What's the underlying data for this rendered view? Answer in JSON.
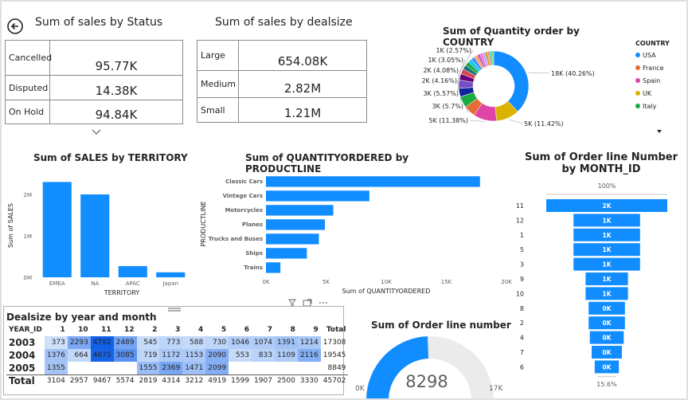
{
  "colors": {
    "accent": "#118DFF",
    "usa": "#118DFF",
    "france": "#E66C37",
    "spain": "#E044A7",
    "uk": "#D9B300",
    "italy": "#1AAB40"
  },
  "status_card": {
    "title": "Sum of sales by Status",
    "back_icon": "back-arrow-icon",
    "rows": [
      {
        "label": "Cancelled",
        "value": "95.77K"
      },
      {
        "label": "Disputed",
        "value": "14.38K"
      },
      {
        "label": "On Hold",
        "value": "94.84K"
      }
    ],
    "scroll_icon": "chevron-down-icon"
  },
  "dealsize_card": {
    "title": "Sum of sales by dealsize",
    "rows": [
      {
        "label": "Large",
        "value": "654.08K"
      },
      {
        "label": "Medium",
        "value": "2.82M"
      },
      {
        "label": "Small",
        "value": "1.21M"
      }
    ]
  },
  "country_chart": {
    "title": "Sum of Quantity order by COUNTRY",
    "legend_title": "COUNTRY",
    "legend": [
      {
        "name": "USA",
        "color": "#118DFF"
      },
      {
        "name": "France",
        "color": "#E66C37"
      },
      {
        "name": "Spain",
        "color": "#E044A7"
      },
      {
        "name": "UK",
        "color": "#D9B300"
      },
      {
        "name": "Italy",
        "color": "#1AAB40"
      }
    ],
    "more_icon": "dropdown-triangle-icon",
    "chart_data": {
      "type": "pie",
      "variant": "donut",
      "slices": [
        {
          "label": "18K (40.26%)",
          "value": 40.26,
          "color": "#118DFF"
        },
        {
          "label": "5K (11.42%)",
          "value": 11.42,
          "color": "#D9B300"
        },
        {
          "label": "5K (11.38%)",
          "value": 11.38,
          "color": "#E044A7"
        },
        {
          "label": "3K (5.7%)",
          "value": 5.7,
          "color": "#E66C37"
        },
        {
          "label": "3K (5.57%)",
          "value": 5.57,
          "color": "#1AAB40"
        },
        {
          "label": "2K (4.16%)",
          "value": 4.16,
          "color": "#12239E"
        },
        {
          "label": "2K (4.08%)",
          "value": 4.08,
          "color": "#744EC2"
        },
        {
          "label": "1K (3.05%)",
          "value": 3.05,
          "color": "#6B007B"
        },
        {
          "label": "1K (2.57%)",
          "value": 2.57,
          "color": "#D64550"
        },
        {
          "label": "",
          "value": 2.2,
          "color": "#197278"
        },
        {
          "label": "",
          "value": 2.0,
          "color": "#1AAB40"
        },
        {
          "label": "",
          "value": 1.9,
          "color": "#15C6F4"
        },
        {
          "label": "",
          "value": 1.8,
          "color": "#4092FF"
        },
        {
          "label": "",
          "value": 1.6,
          "color": "#FFA058"
        },
        {
          "label": "",
          "value": 1.5,
          "color": "#BE5DC9"
        },
        {
          "label": "",
          "value": 1.4,
          "color": "#F472D0"
        },
        {
          "label": "",
          "value": 1.3,
          "color": "#B5A1FF"
        },
        {
          "label": "",
          "value": 1.2,
          "color": "#C4A200"
        },
        {
          "label": "",
          "value": 1.1,
          "color": "#FF8080"
        },
        {
          "label": "",
          "value": 1.0,
          "color": "#00DBBC"
        },
        {
          "label": "",
          "value": 0.9,
          "color": "#5BD667"
        }
      ]
    }
  },
  "territory_chart": {
    "title": "Sum of SALES by TERRITORY",
    "chart_data": {
      "type": "bar",
      "categories": [
        "EMEA",
        "NA",
        "APAC",
        "Japan"
      ],
      "values": [
        2.3,
        2.0,
        0.27,
        0.12
      ],
      "ylim": [
        0,
        2.5
      ],
      "yticks": [
        {
          "v": 0,
          "label": "0M"
        },
        {
          "v": 1,
          "label": "1M"
        },
        {
          "v": 2,
          "label": "2M"
        }
      ],
      "xlabel": "TERRITORY",
      "ylabel": "Sum of SALES"
    }
  },
  "productline_chart": {
    "title": "Sum of QUANTITYORDERED by PRODUCTLINE",
    "chart_data": {
      "type": "bar",
      "orientation": "horizontal",
      "categories": [
        "Classic Cars",
        "Vintage Cars",
        "Motorcycles",
        "Planes",
        "Trucks and Buses",
        "Ships",
        "Trains"
      ],
      "values": [
        17800,
        8600,
        5600,
        4900,
        4400,
        3400,
        1200
      ],
      "xlim": [
        0,
        20000
      ],
      "xticks": [
        {
          "v": 0,
          "label": "0K"
        },
        {
          "v": 5000,
          "label": "5K"
        },
        {
          "v": 10000,
          "label": "10K"
        },
        {
          "v": 15000,
          "label": "15K"
        },
        {
          "v": 20000,
          "label": "20K"
        }
      ],
      "xlabel": "Sum of QUANTITYORDERED",
      "ylabel": "PRODUCTLINE"
    }
  },
  "funnel_chart": {
    "title": "Sum of Order line Number by MONTH_ID",
    "top_label": "100%",
    "bottom_label": "15.6%",
    "chart_data": {
      "type": "bar",
      "variant": "funnel",
      "categories": [
        "11",
        "12",
        "1",
        "5",
        "3",
        "9",
        "10",
        "8",
        "2",
        "4",
        "7",
        "6"
      ],
      "values": [
        1,
        0.55,
        0.55,
        0.55,
        0.55,
        0.35,
        0.35,
        0.3,
        0.3,
        0.28,
        0.25,
        0.2
      ],
      "labels": [
        "2K",
        "1K",
        "1K",
        "1K",
        "1K",
        "1K",
        "1K",
        "0K",
        "0K",
        "0K",
        "0K",
        "0K"
      ]
    }
  },
  "matrix": {
    "title": "Dealsize by year and month",
    "toolbar_icons": [
      "filter-icon",
      "focus-mode-icon",
      "more-options-icon"
    ],
    "drag_handle": "drag-handle-icon",
    "headers": [
      "YEAR_ID",
      "1",
      "10",
      "11",
      "12",
      "2",
      "3",
      "4",
      "5",
      "6",
      "7",
      "8",
      "9",
      "Total"
    ],
    "rows": [
      {
        "year": "2003",
        "cells": [
          "373",
          "2293",
          "4792",
          "2489",
          "545",
          "773",
          "588",
          "730",
          "1046",
          "1074",
          "1391",
          "1214"
        ],
        "total": "17308"
      },
      {
        "year": "2004",
        "cells": [
          "1376",
          "664",
          "4675",
          "3085",
          "719",
          "1172",
          "1153",
          "2090",
          "553",
          "833",
          "1109",
          "2116"
        ],
        "total": "19545"
      },
      {
        "year": "2005",
        "cells": [
          "1355",
          "",
          "",
          "",
          "1555",
          "2369",
          "1471",
          "2099",
          "",
          "",
          "",
          ""
        ],
        "total": "8849"
      }
    ],
    "total_row": {
      "label": "Total",
      "cells": [
        "3104",
        "2957",
        "9467",
        "5574",
        "2819",
        "4314",
        "3212",
        "4919",
        "1599",
        "1907",
        "2500",
        "3330"
      ],
      "total": "45702"
    }
  },
  "gauge": {
    "title": "Sum of Order line number",
    "value": "8298",
    "min_label": "0K",
    "max_label": "17K",
    "fraction": 0.488
  }
}
